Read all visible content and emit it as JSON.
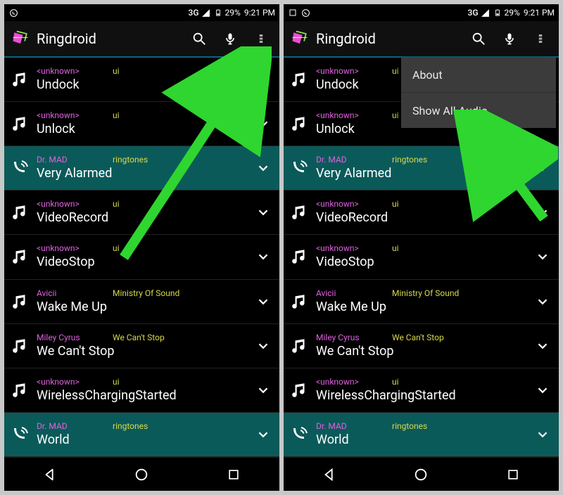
{
  "status": {
    "network": "3G",
    "battery": "29%",
    "time": "9:21 PM"
  },
  "app": {
    "title": "Ringdroid"
  },
  "menu": {
    "about": "About",
    "show_all": "Show All Audio"
  },
  "songs": [
    {
      "artist": "<unknown>",
      "album": "ui",
      "title": "Undock",
      "type": "music"
    },
    {
      "artist": "<unknown>",
      "album": "ui",
      "title": "Unlock",
      "type": "music"
    },
    {
      "artist": "Dr. MAD",
      "album": "ringtones",
      "title": "Very Alarmed",
      "type": "ringtone"
    },
    {
      "artist": "<unknown>",
      "album": "ui",
      "title": "VideoRecord",
      "type": "music"
    },
    {
      "artist": "<unknown>",
      "album": "ui",
      "title": "VideoStop",
      "type": "music"
    },
    {
      "artist": "Avicii",
      "album": "Ministry Of Sound",
      "title": "Wake Me Up",
      "type": "music"
    },
    {
      "artist": "Miley Cyrus",
      "album": "We Can't Stop",
      "title": "We Can't Stop",
      "type": "music"
    },
    {
      "artist": "<unknown>",
      "album": "ui",
      "title": "WirelessChargingStarted",
      "type": "music"
    },
    {
      "artist": "Dr. MAD",
      "album": "ringtones",
      "title": "World",
      "type": "ringtone"
    }
  ]
}
